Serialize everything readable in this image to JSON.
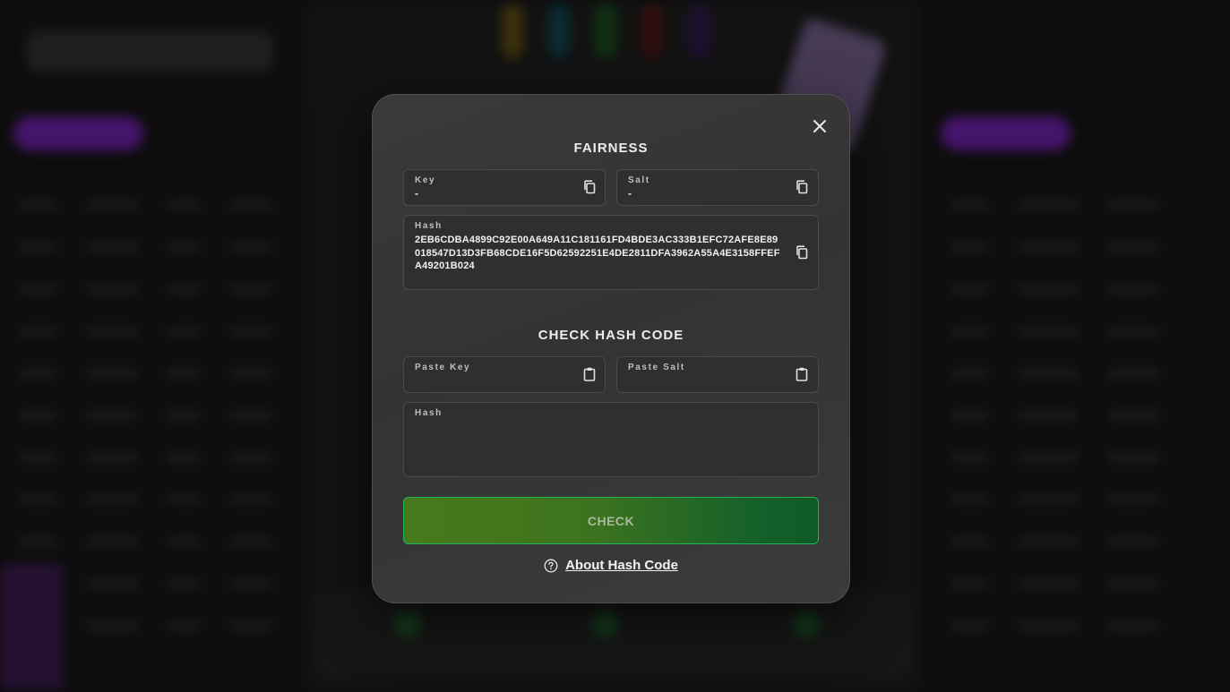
{
  "modal": {
    "close_icon": "close-icon",
    "fairness": {
      "title": "FAIRNESS",
      "key": {
        "label": "Key",
        "value": "-",
        "icon": "copy-icon"
      },
      "salt": {
        "label": "Salt",
        "value": "-",
        "icon": "copy-icon"
      },
      "hash": {
        "label": "Hash",
        "value": "2EB6CDBA4899C92E00A649A11C181161FD4BDE3AC333B1EFC72AFE8E89018547D13D3FB68CDE16F5D62592251E4DE2811DFA3962A55A4E3158FFEFA49201B024",
        "icon": "copy-icon"
      }
    },
    "check": {
      "title": "CHECK HASH CODE",
      "key": {
        "label": "Paste Key",
        "value": "",
        "icon": "paste-icon"
      },
      "salt": {
        "label": "Paste Salt",
        "value": "",
        "icon": "paste-icon"
      },
      "hash": {
        "label": "Hash",
        "value": ""
      },
      "button_label": "CHECK",
      "button_color": "#3d731e",
      "button_border_color": "#22b45a"
    },
    "about": {
      "icon": "help-circle-icon",
      "label": "About Hash Code"
    }
  }
}
